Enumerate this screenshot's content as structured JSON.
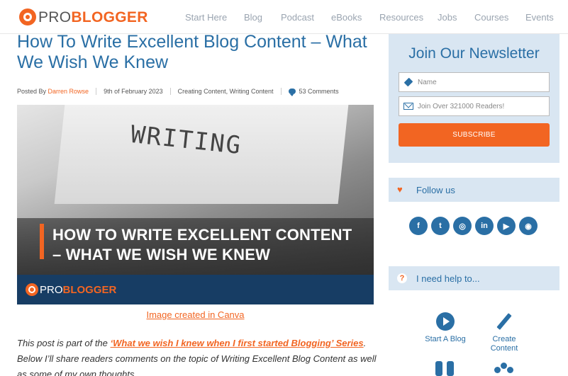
{
  "header": {
    "logo_pro": "PRO",
    "logo_blogger": "BLOGGER",
    "nav": [
      "Start Here",
      "Blog",
      "Podcast",
      "eBooks",
      "Resources",
      "Jobs",
      "Courses",
      "Events"
    ]
  },
  "article": {
    "title": "How To Write Excellent Blog Content – What We Wish We Knew",
    "meta": {
      "posted_by": "Posted By",
      "author": "Darren Rowse",
      "date": "9th of February 2023",
      "categories": "Creating Content, Writing Content",
      "comments": "53 Comments"
    },
    "hero": {
      "writing_text": "WRITING",
      "headline_line1": "HOW TO WRITE EXCELLENT CONTENT",
      "headline_line2": "– WHAT WE WISH WE KNEW",
      "logo_pro": "PRO",
      "logo_blogger": "BLOGGER"
    },
    "caption": "Image created in Canva",
    "intro": {
      "prefix": "This post is part of the ",
      "link": "‘What we wish I knew when I first started Blogging’ Series",
      "suffix": ". Below I’ll share readers comments on the topic of Writing Excellent Blog Content as well as some of my own thoughts."
    }
  },
  "sidebar": {
    "newsletter": {
      "title": "Join Our Newsletter",
      "name_placeholder": "Name",
      "email_placeholder": "Join Over 321000 Readers!",
      "subscribe": "SUBSCRIBE"
    },
    "follow": {
      "label": "Follow us",
      "icons": [
        "facebook-icon",
        "twitter-icon",
        "podcast-icon",
        "linkedin-icon",
        "youtube-icon",
        "rss-icon"
      ],
      "glyphs": [
        "f",
        "t",
        "◎",
        "in",
        "▶",
        "◉"
      ]
    },
    "help": {
      "label": "I need help to...",
      "tiles": [
        {
          "label": "Start A Blog",
          "icon": "play-circle-icon"
        },
        {
          "label": "Create Content",
          "icon": "pencil-icon"
        }
      ]
    }
  },
  "colors": {
    "brand_blue": "#2a6fa5",
    "brand_orange": "#f26522",
    "sidebar_bg": "#d9e6f2",
    "hero_footer": "#173d64"
  }
}
